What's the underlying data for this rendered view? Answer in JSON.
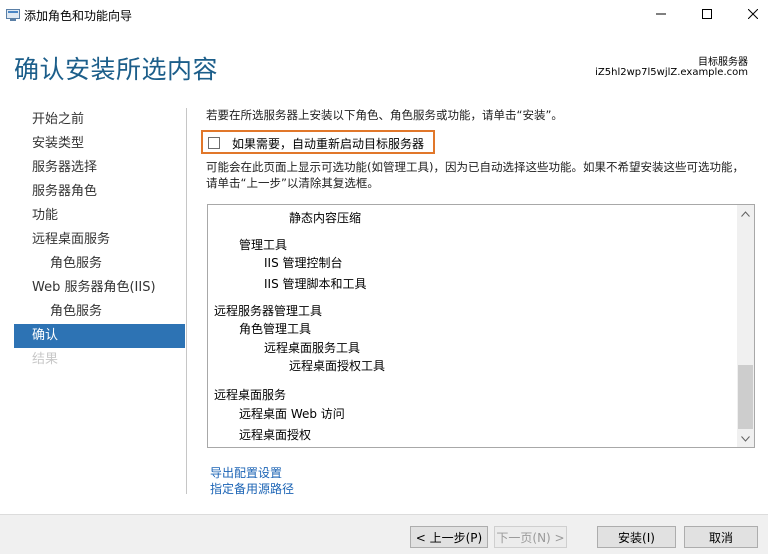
{
  "window": {
    "title": "添加角色和功能向导"
  },
  "header": {
    "page_title": "确认安装所选内容",
    "destination_label": "目标服务器",
    "destination_server": "iZ5hl2wp7l5wjlZ.example.com"
  },
  "nav": {
    "items": [
      {
        "label": "开始之前",
        "level": 0,
        "state": "normal"
      },
      {
        "label": "安装类型",
        "level": 0,
        "state": "normal"
      },
      {
        "label": "服务器选择",
        "level": 0,
        "state": "normal"
      },
      {
        "label": "服务器角色",
        "level": 0,
        "state": "normal"
      },
      {
        "label": "功能",
        "level": 0,
        "state": "normal"
      },
      {
        "label": "远程桌面服务",
        "level": 0,
        "state": "normal"
      },
      {
        "label": "角色服务",
        "level": 1,
        "state": "normal"
      },
      {
        "label": "Web 服务器角色(IIS)",
        "level": 0,
        "state": "normal"
      },
      {
        "label": "角色服务",
        "level": 1,
        "state": "normal"
      },
      {
        "label": "确认",
        "level": 0,
        "state": "active"
      },
      {
        "label": "结果",
        "level": 0,
        "state": "disabled"
      }
    ]
  },
  "content": {
    "intro": "若要在所选服务器上安装以下角色、角色服务或功能，请单击“安装”。",
    "restart_checkbox_label": "如果需要，自动重新启动目标服务器",
    "restart_checked": false,
    "note": "可能会在此页面上显示可选功能(如管理工具)，因为已自动选择这些功能。如果不希望安装这些可选功能，请单击“上一步”以清除其复选框。",
    "items": [
      {
        "text": "静态内容压缩"
      },
      {
        "text": "管理工具"
      },
      {
        "text": "IIS 管理控制台"
      },
      {
        "text": "IIS 管理脚本和工具"
      },
      {
        "text": "远程服务器管理工具"
      },
      {
        "text": "角色管理工具"
      },
      {
        "text": "远程桌面服务工具"
      },
      {
        "text": "远程桌面授权工具"
      },
      {
        "text": "远程桌面服务"
      },
      {
        "text": "远程桌面 Web 访问"
      },
      {
        "text": "远程桌面授权"
      }
    ],
    "links": {
      "export": "导出配置设置",
      "alt_source": "指定备用源路径"
    }
  },
  "footer": {
    "prev": "< 上一步(P)",
    "next": "下一页(N) >",
    "install": "安装(I)",
    "cancel": "取消"
  },
  "colors": {
    "title": "#1c5e8a",
    "accent_active": "#2d73b4",
    "highlight_box": "#e1772a",
    "link": "#1c64b5"
  }
}
